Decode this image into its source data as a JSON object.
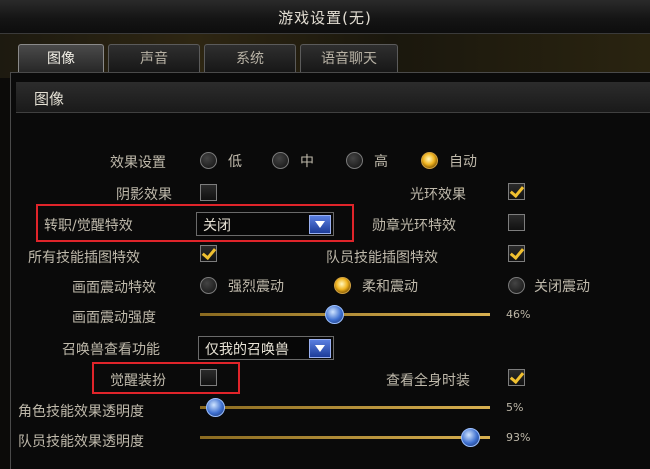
{
  "window": {
    "title": "游戏设置(无)"
  },
  "tabs": [
    "图像",
    "声音",
    "系统",
    "语音聊天"
  ],
  "section": {
    "title": "图像"
  },
  "effect_setting": {
    "label": "效果设置",
    "options": [
      "低",
      "中",
      "高",
      "自动"
    ],
    "selected": "自动"
  },
  "shadow": {
    "label": "阴影效果",
    "checked": false
  },
  "halo": {
    "label": "光环效果",
    "checked": true
  },
  "awaken_effect": {
    "label": "转职/觉醒特效",
    "value": "关闭"
  },
  "medal_halo": {
    "label": "勋章光环特效",
    "checked": false
  },
  "all_skill_art": {
    "label": "所有技能插图特效",
    "checked": true
  },
  "party_skill_art": {
    "label": "队员技能插图特效",
    "checked": true
  },
  "screen_shake": {
    "label": "画面震动特效",
    "options": [
      "强烈震动",
      "柔和震动",
      "关闭震动"
    ],
    "selected": "柔和震动"
  },
  "shake_strength": {
    "label": "画面震动强度",
    "value": 46,
    "display": "46%"
  },
  "summon_view": {
    "label": "召唤兽查看功能",
    "value": "仅我的召唤兽"
  },
  "awaken_costume": {
    "label": "觉醒装扮",
    "checked": false
  },
  "full_costume": {
    "label": "查看全身时装",
    "checked": true
  },
  "char_skill_opacity": {
    "label": "角色技能效果透明度",
    "value": 5,
    "display": "5%"
  },
  "party_skill_opacity": {
    "label": "队员技能效果透明度",
    "value": 93,
    "display": "93%"
  },
  "colors": {
    "highlight_box": "#e0242a",
    "accent_gold": "#f0b420",
    "slider_knob": "#3d6fd0"
  }
}
